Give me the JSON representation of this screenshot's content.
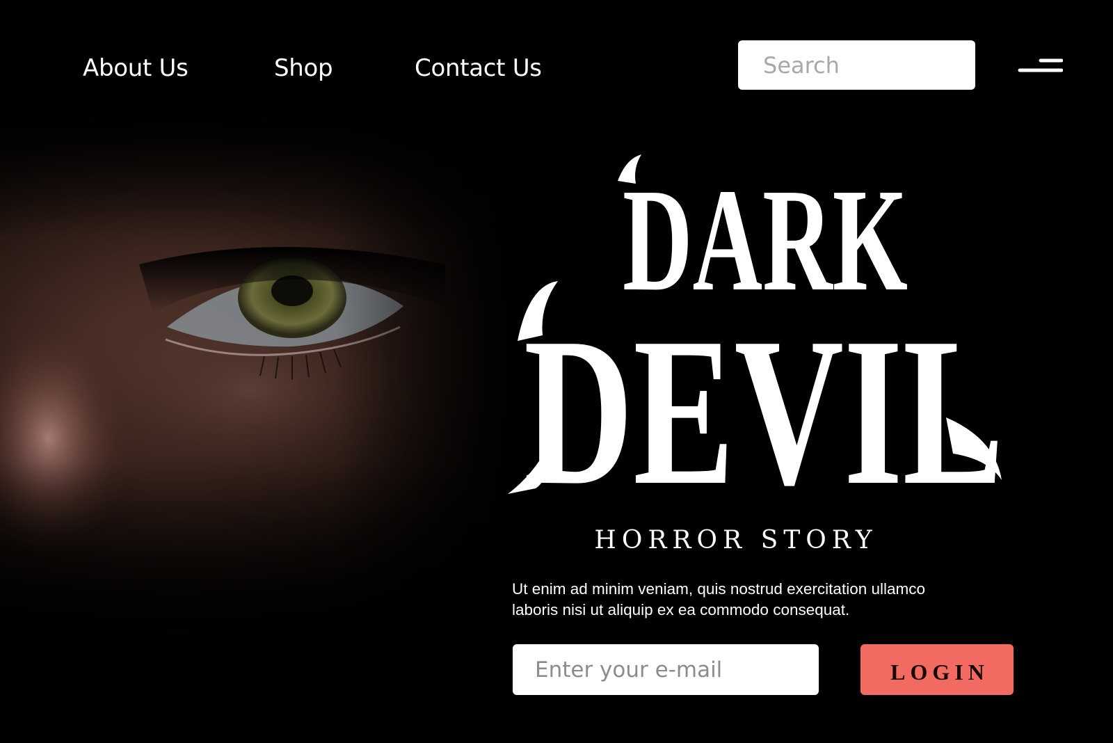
{
  "nav": {
    "links": [
      {
        "label": "About Us"
      },
      {
        "label": "Shop"
      },
      {
        "label": "Contact Us"
      }
    ],
    "search": {
      "placeholder": "Search"
    },
    "menu_icon": "hamburger-menu-icon"
  },
  "hero": {
    "title_line_1": "DARK",
    "title_line_2": "DEVIL",
    "tagline": "HORROR STORY",
    "description_lines": [
      "Ut enim ad minim veniam, quis nostrud exercitation ullamco",
      "laboris nisi ut aliquip ex ea commodo consequat."
    ],
    "email": {
      "placeholder": "Enter your e-mail"
    },
    "login_label": "LOGIN"
  },
  "colors": {
    "background": "#000000",
    "text": "#ffffff",
    "login_button": "#f26b63",
    "input_background": "#ffffff"
  }
}
